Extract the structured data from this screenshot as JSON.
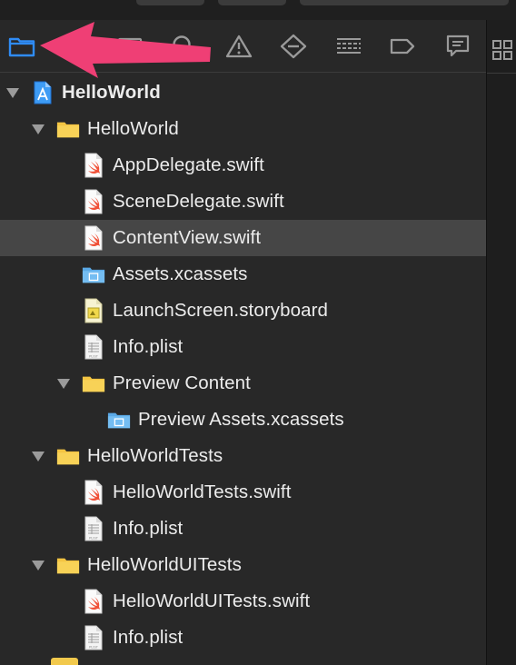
{
  "toolbar": {
    "icons": [
      {
        "name": "project-navigator-icon",
        "active": true
      },
      {
        "name": "source-control-icon",
        "active": false
      },
      {
        "name": "find-icon",
        "active": false
      },
      {
        "name": "issue-warning-icon",
        "active": false
      },
      {
        "name": "test-diamond-icon",
        "active": false
      },
      {
        "name": "debug-list-icon",
        "active": false
      },
      {
        "name": "breakpoint-tag-icon",
        "active": false
      },
      {
        "name": "report-bubble-icon",
        "active": false
      }
    ],
    "accent_color": "#2f8cf6",
    "icon_color": "#9a9a9a"
  },
  "annotation": {
    "type": "arrow",
    "color": "#ef3f75",
    "points_to": "project-navigator-icon"
  },
  "tree": {
    "selected_color": "#464646",
    "items": [
      {
        "label": "HelloWorld",
        "kind": "project",
        "expanded": true,
        "depth": 0
      },
      {
        "label": "HelloWorld",
        "kind": "folder",
        "expanded": true,
        "depth": 1
      },
      {
        "label": "AppDelegate.swift",
        "kind": "swift",
        "depth": 2
      },
      {
        "label": "SceneDelegate.swift",
        "kind": "swift",
        "depth": 2
      },
      {
        "label": "ContentView.swift",
        "kind": "swift",
        "depth": 2,
        "selected": true
      },
      {
        "label": "Assets.xcassets",
        "kind": "assets",
        "depth": 2
      },
      {
        "label": "LaunchScreen.storyboard",
        "kind": "storyboard",
        "depth": 2
      },
      {
        "label": "Info.plist",
        "kind": "plist",
        "depth": 2
      },
      {
        "label": "Preview Content",
        "kind": "folder",
        "expanded": true,
        "depth": 2
      },
      {
        "label": "Preview Assets.xcassets",
        "kind": "assets",
        "depth": 3
      },
      {
        "label": "HelloWorldTests",
        "kind": "folder",
        "expanded": true,
        "depth": 1
      },
      {
        "label": "HelloWorldTests.swift",
        "kind": "swift",
        "depth": 2
      },
      {
        "label": "Info.plist",
        "kind": "plist",
        "depth": 2
      },
      {
        "label": "HelloWorldUITests",
        "kind": "folder",
        "expanded": true,
        "depth": 1
      },
      {
        "label": "HelloWorldUITests.swift",
        "kind": "swift",
        "depth": 2
      },
      {
        "label": "Info.plist",
        "kind": "plist",
        "depth": 2
      }
    ]
  }
}
